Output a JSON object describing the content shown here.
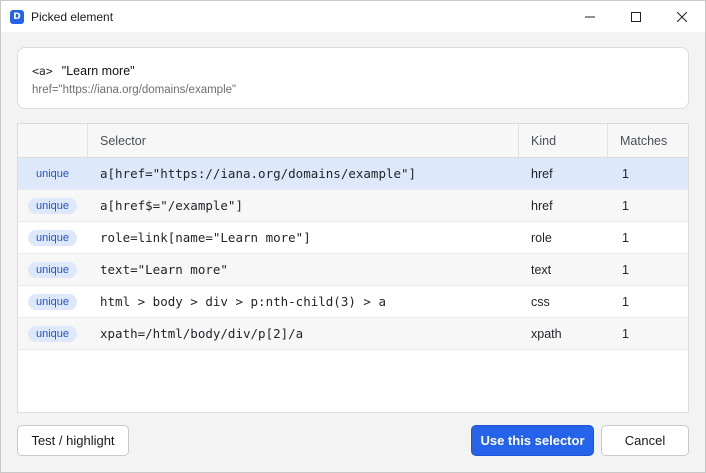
{
  "window": {
    "app_icon_letter": "D",
    "title": "Picked element",
    "controls": [
      "minimize",
      "maximize",
      "close"
    ]
  },
  "element": {
    "tag": "<a>",
    "text": "\"Learn more\"",
    "attribute": "href=\"https://iana.org/domains/example\""
  },
  "table": {
    "headers": [
      "",
      "Selector",
      "Kind",
      "Matches"
    ],
    "selected_row": 0,
    "rows": [
      {
        "badge": "unique",
        "selector": "a[href=\"https://iana.org/domains/example\"]",
        "kind": "href",
        "matches": "1"
      },
      {
        "badge": "unique",
        "selector": "a[href$=\"/example\"]",
        "kind": "href",
        "matches": "1"
      },
      {
        "badge": "unique",
        "selector": "role=link[name=\"Learn more\"]",
        "kind": "role",
        "matches": "1"
      },
      {
        "badge": "unique",
        "selector": "text=\"Learn more\"",
        "kind": "text",
        "matches": "1"
      },
      {
        "badge": "unique",
        "selector": "html > body > div > p:nth-child(3) > a",
        "kind": "css",
        "matches": "1"
      },
      {
        "badge": "unique",
        "selector": "xpath=/html/body/div/p[2]/a",
        "kind": "xpath",
        "matches": "1"
      }
    ]
  },
  "footer": {
    "test_label": "Test / highlight",
    "use_label": "Use this selector",
    "cancel_label": "Cancel"
  },
  "colors": {
    "accent": "#2563eb",
    "selected_row": "#dde8fb",
    "badge_text": "#2456c6"
  }
}
